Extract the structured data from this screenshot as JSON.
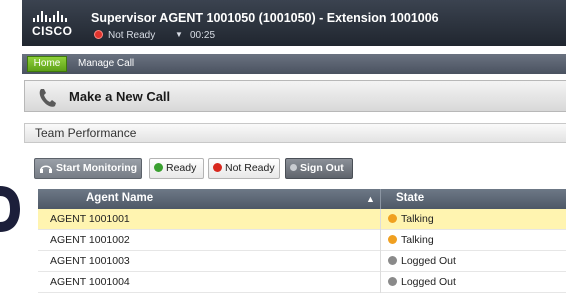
{
  "header": {
    "brand": "CISCO",
    "title": "Supervisor AGENT 1001050 (1001050) - Extension 1001006",
    "status": "Not Ready",
    "timer": "00:25"
  },
  "nav": {
    "home": "Home",
    "manage_call": "Manage Call"
  },
  "call_bar": {
    "label": "Make a New Call"
  },
  "team_performance": {
    "title": "Team Performance",
    "buttons": {
      "start_monitoring": "Start Monitoring",
      "ready": "Ready",
      "not_ready": "Not Ready",
      "sign_out": "Sign Out"
    },
    "columns": {
      "agent_name": "Agent Name",
      "state": "State"
    },
    "rows": [
      {
        "agent": "AGENT 1001001",
        "state": "Talking",
        "selected": true
      },
      {
        "agent": "AGENT 1001002",
        "state": "Talking",
        "selected": false
      },
      {
        "agent": "AGENT 1001003",
        "state": "Logged Out",
        "selected": false
      },
      {
        "agent": "AGENT 1001004",
        "state": "Logged Out",
        "selected": false
      }
    ]
  },
  "colors": {
    "header_bg": "#2a313b",
    "home_tab": "#6fb421",
    "selected_row": "#fff4b0",
    "talking": "#f0a020",
    "logged_out": "#8a8a8a",
    "ready": "#3aa030",
    "not_ready": "#d8281e"
  }
}
